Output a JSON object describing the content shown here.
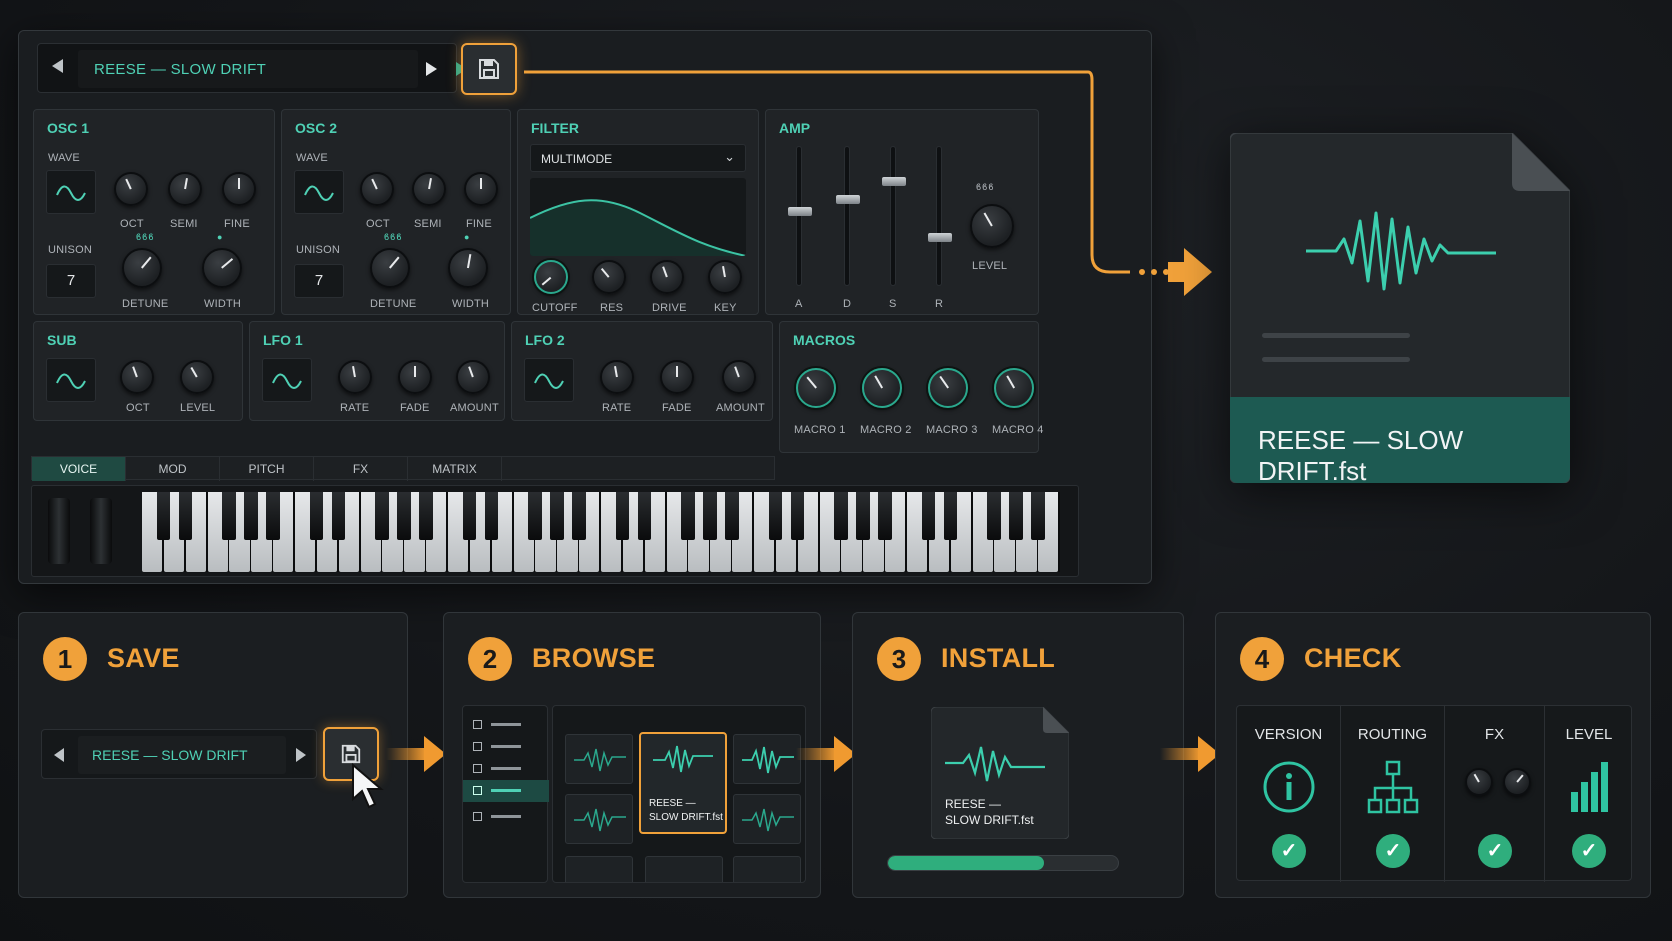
{
  "preset": {
    "name": "REESE — SLOW DRIFT"
  },
  "osc1": {
    "title": "OSC 1",
    "wave": "WAVE",
    "knobs": [
      "OCT",
      "SEMI",
      "FINE"
    ],
    "unison": "UNISON",
    "unison_value": "7",
    "dots": "ϐϐϐ",
    "knobs2": [
      "DETUNE",
      "WIDTH"
    ]
  },
  "osc2": {
    "title": "OSC 2",
    "wave": "WAVE",
    "knobs": [
      "OCT",
      "SEMI",
      "FINE"
    ],
    "unison": "UNISON",
    "unison_value": "7",
    "dots": "ϐϐϐ",
    "knobs2": [
      "DETUNE",
      "WIDTH"
    ]
  },
  "filter": {
    "title": "FILTER",
    "mode": "MULTIMODE",
    "knobs": [
      "CUTOFF",
      "RES",
      "DRIVE",
      "KEY"
    ]
  },
  "amp": {
    "title": "AMP",
    "sliders": [
      "A",
      "D",
      "S",
      "R"
    ],
    "level": "LEVEL",
    "level_dots": "ϐϐϐ"
  },
  "sub": {
    "title": "SUB",
    "knobs": [
      "OCT",
      "LEVEL"
    ]
  },
  "lfo1": {
    "title": "LFO 1",
    "knobs": [
      "RATE",
      "FADE",
      "AMOUNT"
    ]
  },
  "lfo2": {
    "title": "LFO 2",
    "knobs": [
      "RATE",
      "FADE",
      "AMOUNT"
    ]
  },
  "macros": {
    "title": "MACROS",
    "knobs": [
      "MACRO 1",
      "MACRO 2",
      "MACRO 3",
      "MACRO 4"
    ]
  },
  "tabs": [
    "VOICE",
    "MOD",
    "PITCH",
    "FX",
    "MATRIX"
  ],
  "file": {
    "name": "REESE — SLOW DRIFT.fst"
  },
  "steps": {
    "save": {
      "num": "1",
      "title": "SAVE",
      "preset": "REESE — SLOW DRIFT"
    },
    "browse": {
      "num": "2",
      "title": "BROWSE",
      "file_line1": "REESE —",
      "file_line2": "SLOW DRIFT.fst"
    },
    "install": {
      "num": "3",
      "title": "INSTALL",
      "file_line1": "REESE —",
      "file_line2": "SLOW DRIFT.fst",
      "progress": 0.68
    },
    "check": {
      "num": "4",
      "title": "CHECK",
      "cols": [
        "VERSION",
        "ROUTING",
        "FX",
        "LEVEL"
      ]
    }
  },
  "colors": {
    "teal": "#4fd1b5",
    "orange": "#f0a13a",
    "green": "#2fae7d"
  }
}
